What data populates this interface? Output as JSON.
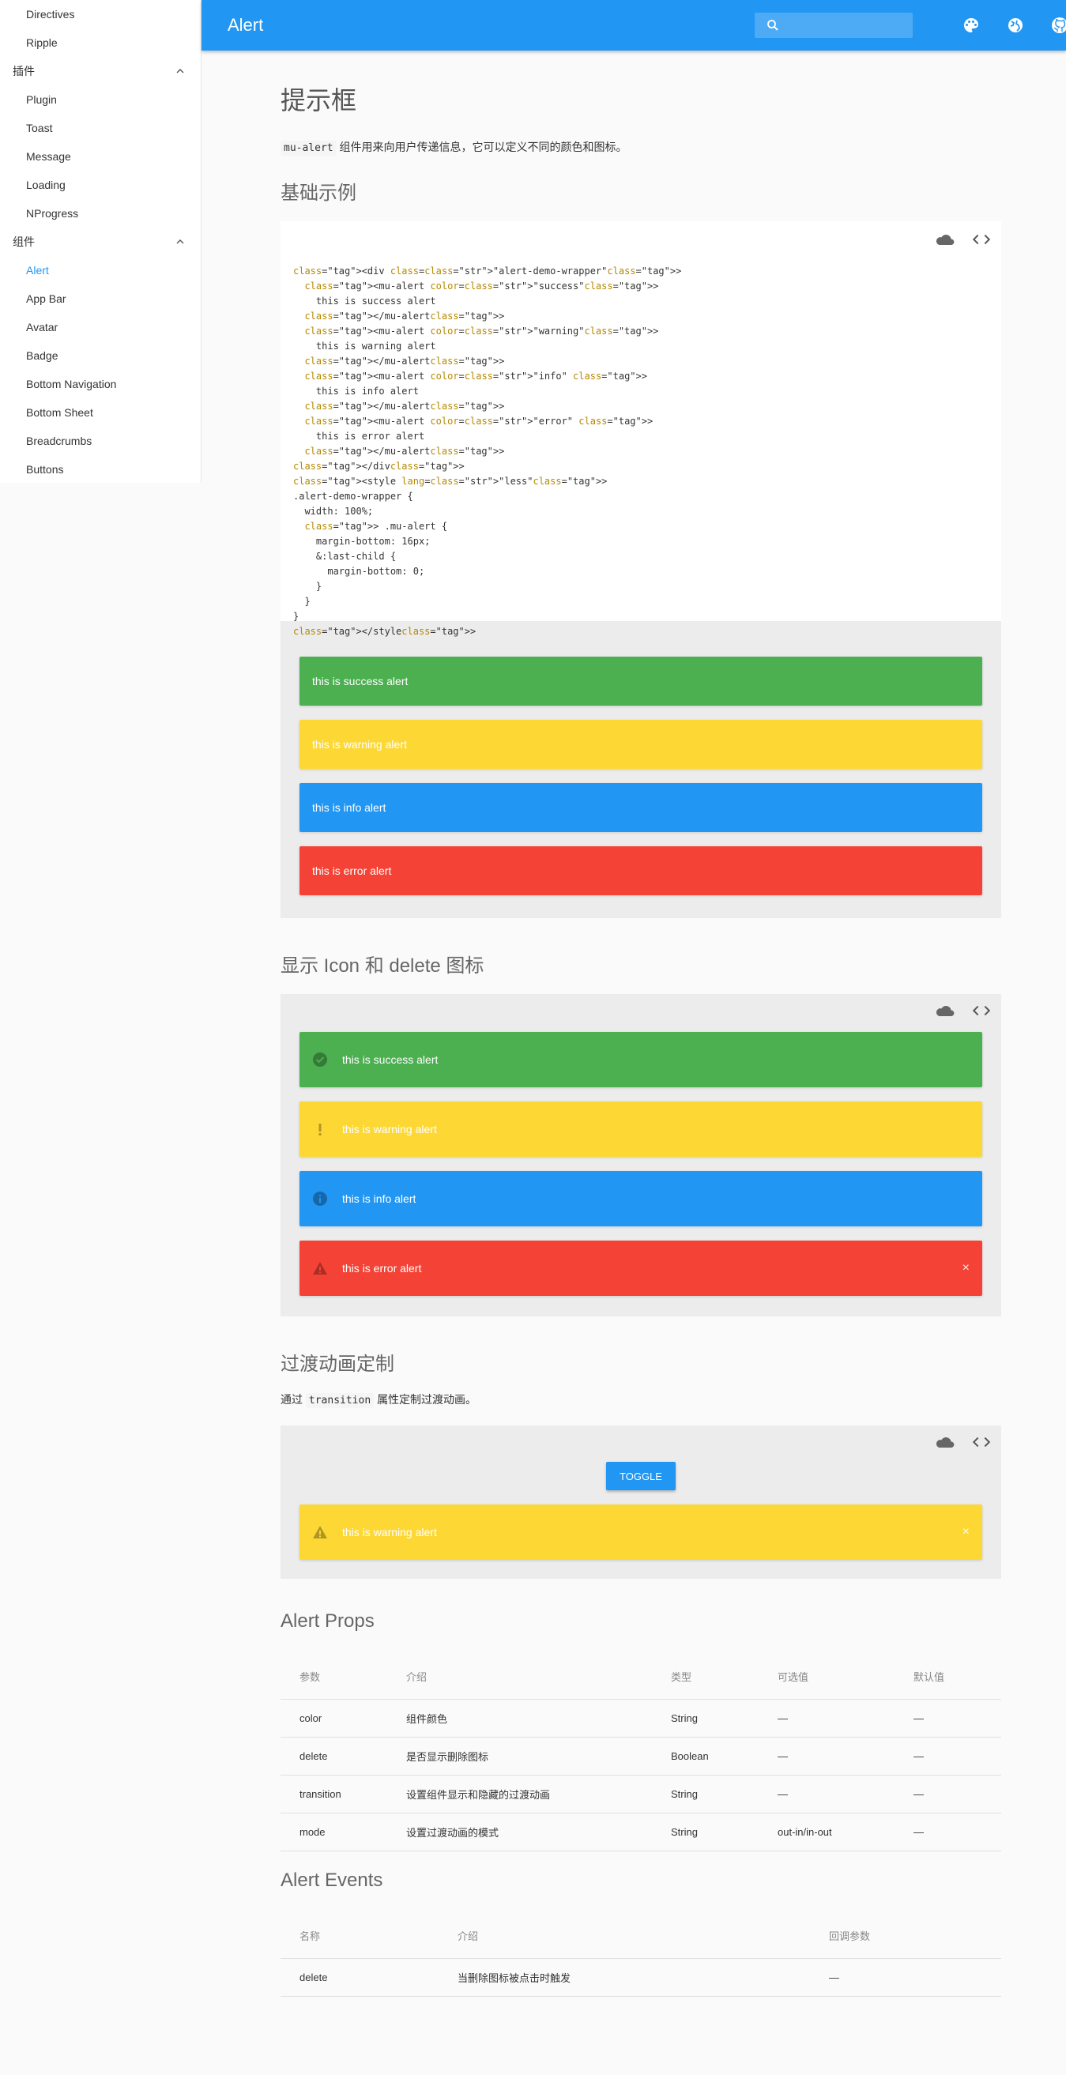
{
  "sidebar": {
    "top_items": [
      "Directives",
      "Ripple"
    ],
    "groups": [
      {
        "label": "插件",
        "items": [
          "Plugin",
          "Toast",
          "Message",
          "Loading",
          "NProgress"
        ]
      },
      {
        "label": "组件",
        "items": [
          "Alert",
          "App Bar",
          "Avatar",
          "Badge",
          "Bottom Navigation",
          "Bottom Sheet",
          "Breadcrumbs",
          "Buttons"
        ]
      }
    ],
    "active_item": "Alert"
  },
  "appbar": {
    "title": "Alert",
    "search_placeholder": "",
    "icons": [
      "palette-icon",
      "globe-icon",
      "github-icon"
    ]
  },
  "page": {
    "title": "提示框",
    "desc_code": "mu-alert",
    "desc_text": "组件用来向用户传递信息，它可以定义不同的颜色和图标。"
  },
  "section_basic": {
    "heading": "基础示例",
    "code_lines": [
      "<div class=\"alert-demo-wrapper\">",
      "  <mu-alert color=\"success\">",
      "    this is success alert",
      "  </mu-alert>",
      "  <mu-alert color=\"warning\">",
      "    this is warning alert",
      "  </mu-alert>",
      "  <mu-alert color=\"info\" >",
      "    this is info alert",
      "  </mu-alert>",
      "  <mu-alert color=\"error\" >",
      "    this is error alert",
      "  </mu-alert>",
      "</div>",
      "<style lang=\"less\">",
      ".alert-demo-wrapper {",
      "  width: 100%;",
      "  > .mu-alert {",
      "    margin-bottom: 16px;",
      "    &:last-child {",
      "      margin-bottom: 0;",
      "    }",
      "  }",
      "}",
      "</style>"
    ],
    "alerts": [
      {
        "color": "success",
        "text": "this is success alert"
      },
      {
        "color": "warning",
        "text": "this is warning alert"
      },
      {
        "color": "info",
        "text": "this is info alert"
      },
      {
        "color": "error",
        "text": "this is error alert"
      }
    ]
  },
  "section_icon": {
    "heading": "显示 Icon 和 delete 图标",
    "alerts": [
      {
        "color": "success",
        "icon": "check-circle-icon",
        "text": "this is success alert"
      },
      {
        "color": "warning",
        "icon": "priority-high-icon",
        "text": "this is warning alert"
      },
      {
        "color": "info",
        "icon": "info-icon",
        "text": "this is info alert"
      },
      {
        "color": "error",
        "icon": "warning-icon",
        "text": "this is error alert",
        "close": "×"
      }
    ]
  },
  "section_transition": {
    "heading": "过渡动画定制",
    "desc_prefix": "通过",
    "desc_code": "transition",
    "desc_suffix": "属性定制过渡动画。",
    "toggle_label": "TOGGLE",
    "alert": {
      "color": "warning",
      "icon": "warning-icon",
      "text": "this is warning alert",
      "close": "×"
    }
  },
  "props": {
    "heading": "Alert Props",
    "columns": [
      "参数",
      "介绍",
      "类型",
      "可选值",
      "默认值"
    ],
    "rows": [
      [
        "color",
        "组件颜色",
        "String",
        "—",
        "—"
      ],
      [
        "delete",
        "是否显示删除图标",
        "Boolean",
        "—",
        "—"
      ],
      [
        "transition",
        "设置组件显示和隐藏的过渡动画",
        "String",
        "—",
        "—"
      ],
      [
        "mode",
        "设置过渡动画的模式",
        "String",
        "out-in/in-out",
        "—"
      ]
    ]
  },
  "events": {
    "heading": "Alert Events",
    "columns": [
      "名称",
      "介绍",
      "回调参数"
    ],
    "rows": [
      [
        "delete",
        "当删除图标被点击时触发",
        "—"
      ]
    ]
  },
  "colors": {
    "primary": "#2196f3",
    "success": "#4caf50",
    "warning": "#fdd835",
    "info": "#2196f3",
    "error": "#f44336"
  }
}
